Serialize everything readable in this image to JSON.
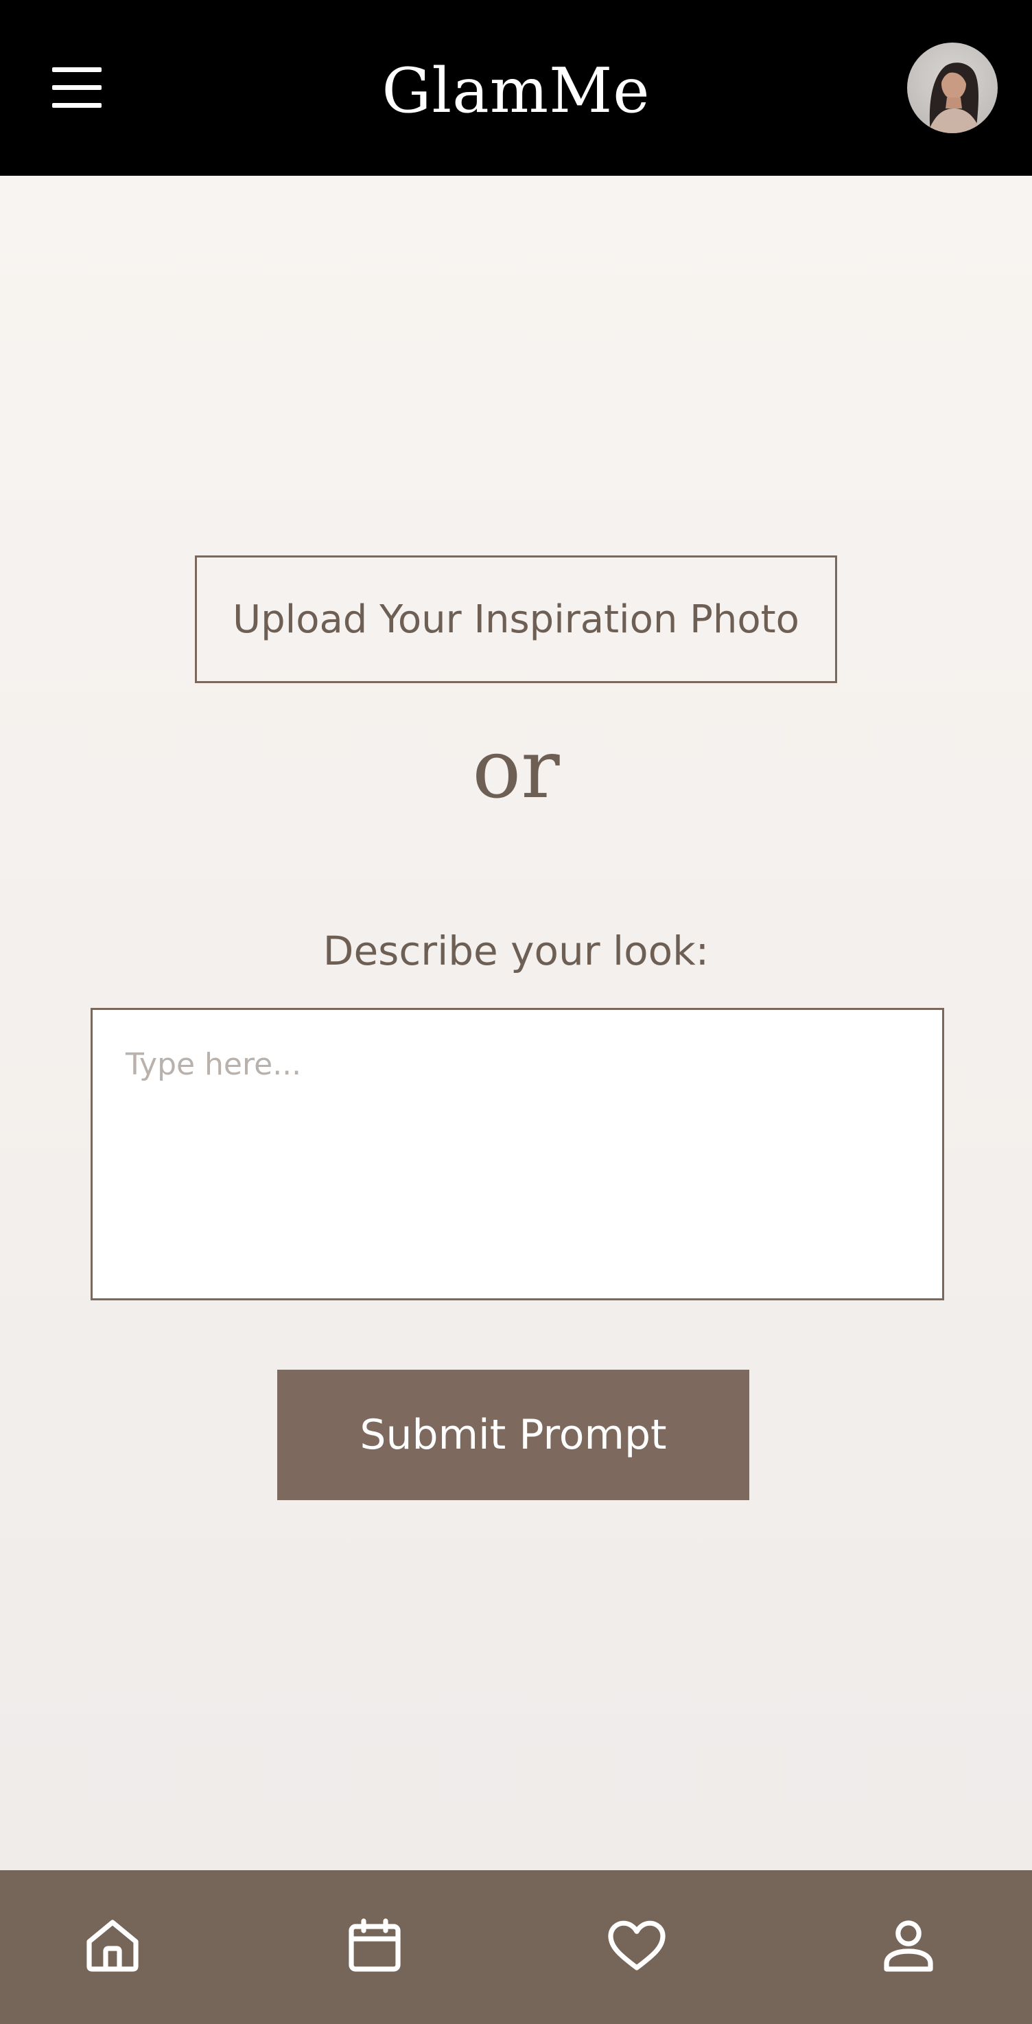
{
  "header": {
    "title": "GlamMe",
    "menu_icon": "hamburger-menu-icon",
    "avatar_icon": "user-avatar"
  },
  "main": {
    "upload_label": "Upload Your Inspiration Photo",
    "or_text": "or",
    "describe_label": "Describe your look:",
    "prompt_placeholder": "Type here...",
    "prompt_value": "",
    "submit_label": "Submit Prompt"
  },
  "bottom_nav": {
    "items": [
      {
        "icon": "home-icon"
      },
      {
        "icon": "calendar-icon"
      },
      {
        "icon": "heart-icon"
      },
      {
        "icon": "profile-icon"
      }
    ]
  },
  "colors": {
    "header_bg": "#000000",
    "accent": "#7d695d",
    "nav_bg": "#766559",
    "text": "#6e5f55"
  }
}
